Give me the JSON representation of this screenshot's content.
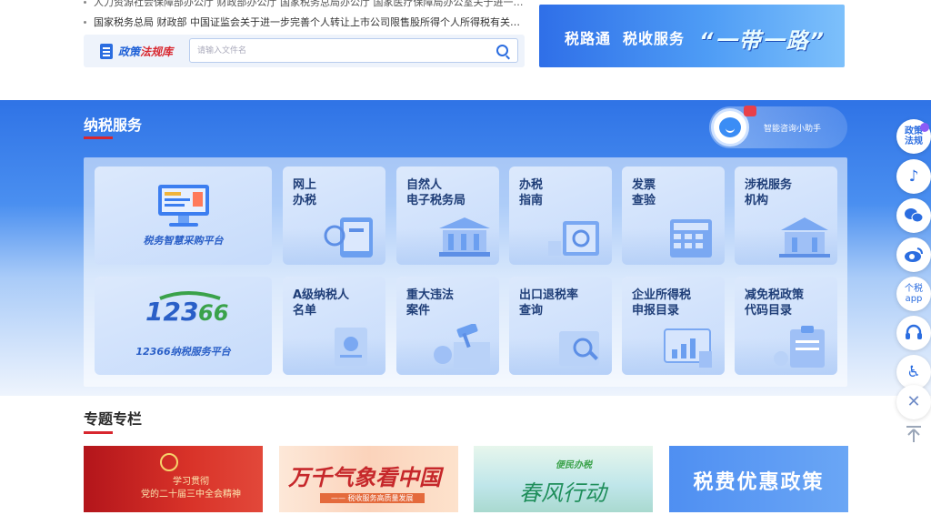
{
  "news": {
    "line1": "人力资源社会保障部办公厅 财政部办公厅 国家税务总局办公厅 国家医疗保障局办公室关于进一步完...",
    "line2": "国家税务总局 财政部 中国证监会关于进一步完善个人转让上市公司限售股所得个人所得税有关征..."
  },
  "policy_search": {
    "logo_part1": "政策",
    "logo_part2": "法规库",
    "placeholder": "请输入文件名",
    "icon": "search-icon"
  },
  "belt_banner": {
    "left_text": "税路通",
    "middle_text": "税收服务",
    "slogan": "“一带一路”"
  },
  "services": {
    "title": "纳税服务",
    "assistant_label": "智能咨询小助手",
    "procurement_label": "税务智慧采购平台",
    "hotline_label": "12366纳税服务平台",
    "items": [
      {
        "label": "网上\n办税"
      },
      {
        "label": "自然人\n电子税务局"
      },
      {
        "label": "办税\n指南"
      },
      {
        "label": "发票\n查验"
      },
      {
        "label": "涉税服务\n机构"
      },
      {
        "label": "A级纳税人\n名单"
      },
      {
        "label": "重大违法\n案件"
      },
      {
        "label": "出口退税率\n查询"
      },
      {
        "label": "企业所得税\n申报目录"
      },
      {
        "label": "减免税政策\n代码目录"
      }
    ]
  },
  "topics": {
    "title": "专题专栏",
    "banner1_text": "学习贯彻\n党的二十届三中全会精神",
    "banner2_text": "万千气象看中国",
    "banner2_sub": "—— 税收服务高质量发展",
    "banner3_sub": "便民办税",
    "banner3_text": "春风行动",
    "banner4_text": "税费优惠政策"
  },
  "sidebar": {
    "policy_label": "政策\n法规",
    "tax_app_label": "个税\napp",
    "icons": [
      "douyin-icon",
      "wechat-icon",
      "weibo-icon",
      "headset-icon",
      "accessibility-icon",
      "close-icon",
      "back-to-top-icon"
    ]
  },
  "colors": {
    "brand_blue": "#2b6de0",
    "accent_red": "#d8262e"
  }
}
